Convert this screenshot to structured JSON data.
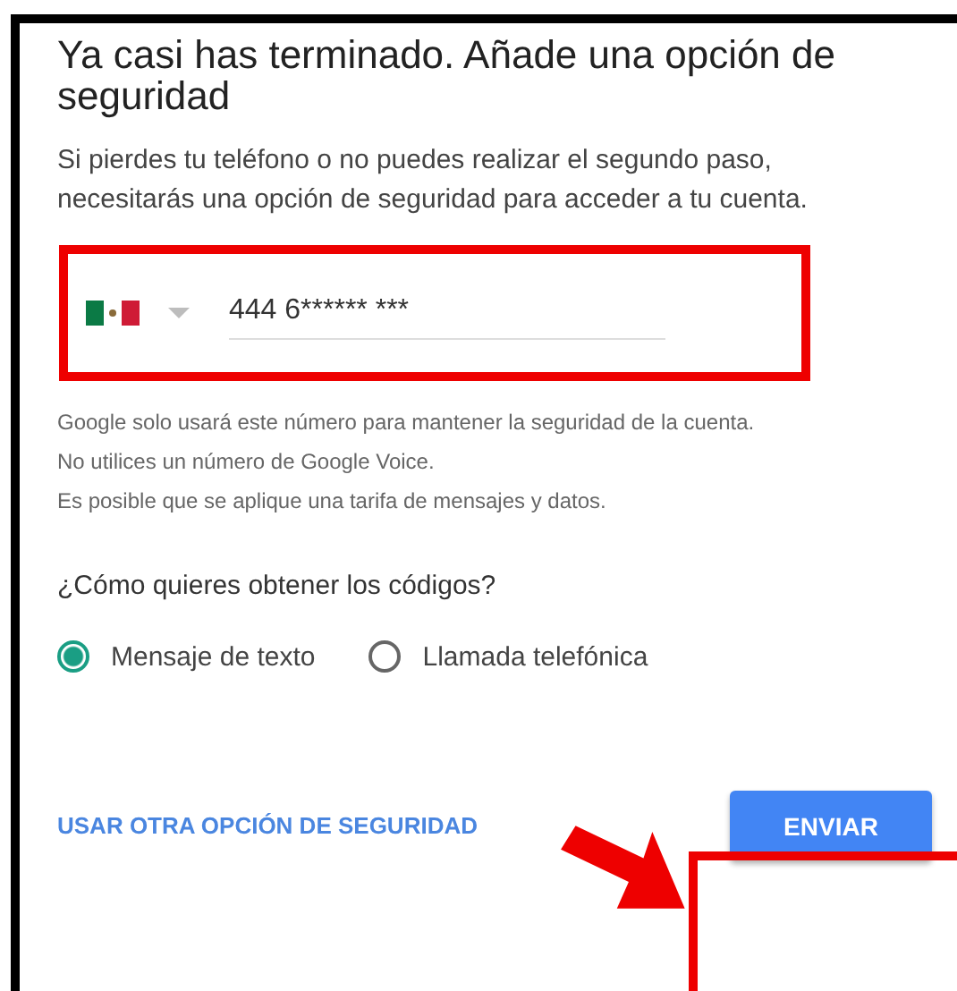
{
  "title": "Ya casi has terminado. Añade una opción de seguridad",
  "intro": "Si pierdes tu teléfono o no puedes realizar el segundo paso, necesitarás una opción de seguridad para acceder a tu cuenta.",
  "phone": {
    "value": "444 6****** ***"
  },
  "notes": [
    "Google solo usará este número para mantener la seguridad de la cuenta.",
    "No utilices un número de Google Voice.",
    "Es posible que se aplique una tarifa de mensajes y datos."
  ],
  "question": "¿Cómo quieres obtener los códigos?",
  "options": [
    {
      "label": "Mensaje de texto",
      "selected": true
    },
    {
      "label": "Llamada telefónica",
      "selected": false
    }
  ],
  "link": "USAR OTRA OPCIÓN DE SEGURIDAD",
  "button": "ENVIAR"
}
